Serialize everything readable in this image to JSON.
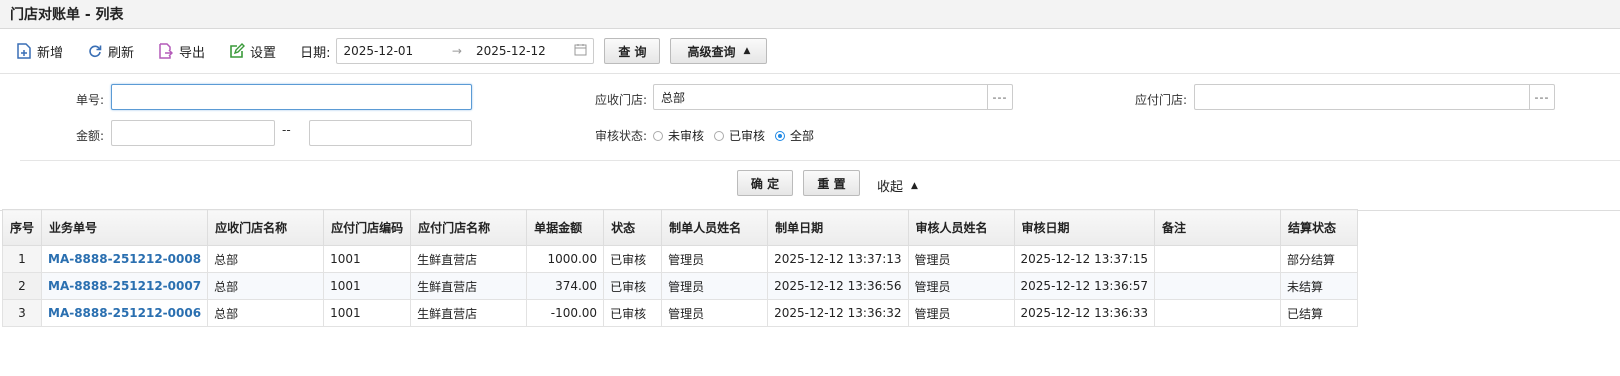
{
  "title": "门店对账单 - 列表",
  "toolbar": {
    "add": "新增",
    "refresh": "刷新",
    "export": "导出",
    "settings": "设置",
    "date_label": "日期:",
    "date_from": "2025-12-01",
    "date_to": "2025-12-12",
    "query": "查 询",
    "advanced": "高级查询"
  },
  "filter": {
    "doc_no_label": "单号:",
    "doc_no_value": "",
    "recv_store_label": "应收门店:",
    "recv_store_value": "总部",
    "pay_store_label": "应付门店:",
    "pay_store_value": "",
    "amount_label": "金额:",
    "amount_sep": "--",
    "audit_label": "审核状态:",
    "audit_options": [
      "未审核",
      "已审核",
      "全部"
    ],
    "audit_selected": "全部",
    "confirm": "确 定",
    "reset": "重 置",
    "collapse": "收起"
  },
  "table": {
    "columns": [
      "序号",
      "业务单号",
      "应收门店名称",
      "应付门店编码",
      "应付门店名称",
      "单据金额",
      "状态",
      "制单人员姓名",
      "制单日期",
      "审核人员姓名",
      "审核日期",
      "备注",
      "结算状态"
    ],
    "rows": [
      {
        "idx": "1",
        "doc": "MA-8888-251212-0008",
        "recv": "总部",
        "pay_code": "1001",
        "pay_name": "生鲜直营店",
        "amount": "1000.00",
        "status": "已审核",
        "maker": "管理员",
        "make_date": "2025-12-12 13:37:13",
        "auditor": "管理员",
        "audit_date": "2025-12-12 13:37:15",
        "remark": "",
        "settle": "部分结算"
      },
      {
        "idx": "2",
        "doc": "MA-8888-251212-0007",
        "recv": "总部",
        "pay_code": "1001",
        "pay_name": "生鲜直营店",
        "amount": "374.00",
        "status": "已审核",
        "maker": "管理员",
        "make_date": "2025-12-12 13:36:56",
        "auditor": "管理员",
        "audit_date": "2025-12-12 13:36:57",
        "remark": "",
        "settle": "未结算"
      },
      {
        "idx": "3",
        "doc": "MA-8888-251212-0006",
        "recv": "总部",
        "pay_code": "1001",
        "pay_name": "生鲜直营店",
        "amount": "-100.00",
        "status": "已审核",
        "maker": "管理员",
        "make_date": "2025-12-12 13:36:32",
        "auditor": "管理员",
        "audit_date": "2025-12-12 13:36:33",
        "remark": "",
        "settle": "已结算"
      }
    ]
  },
  "icons": {
    "add": "file-plus-icon",
    "refresh": "refresh-icon",
    "export": "export-icon",
    "settings": "edit-settings-icon",
    "calendar": "calendar-icon"
  },
  "colors": {
    "link": "#2a6fb0",
    "add_icon": "#3a6fb5",
    "export_icon": "#b45ab9",
    "settings_icon": "#3a9a3a",
    "radio_on": "#1e88e5"
  }
}
